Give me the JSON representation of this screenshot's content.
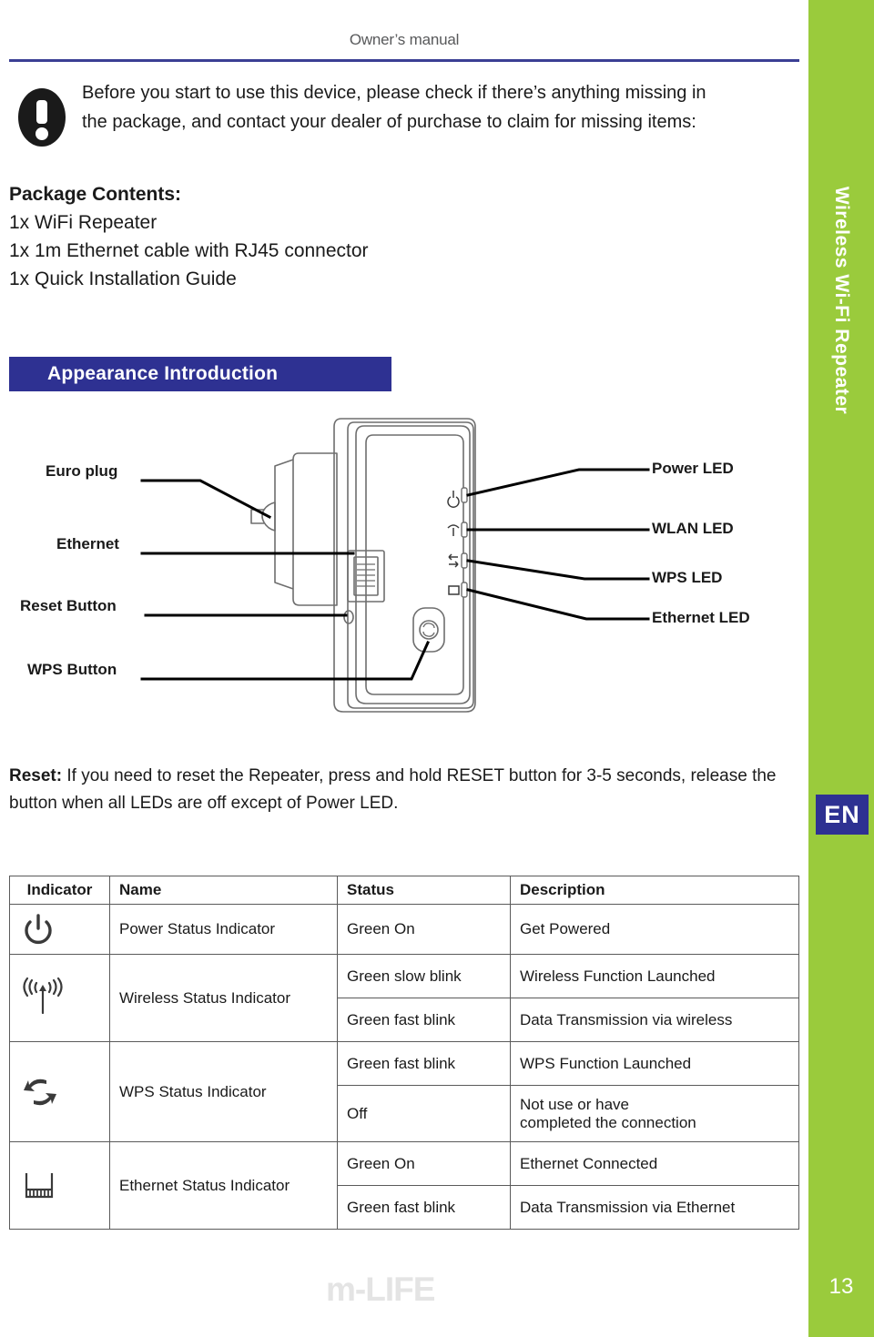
{
  "header": {
    "title": "Owner’s manual"
  },
  "sidebar": {
    "product_title": "Wireless Wi-Fi Repeater",
    "language_badge": "EN",
    "page_number": "13",
    "accent_green": "#9ACB3C",
    "accent_blue": "#2E3192"
  },
  "notice": {
    "icon": "exclamation-icon",
    "line1": "Before you start to use this device, please check if there’s anything missing in",
    "line2": "the package, and contact your dealer of purchase to claim for missing items:"
  },
  "package": {
    "title": "Package Contents:",
    "items": [
      "1x WiFi Repeater",
      "1x 1m Ethernet cable with RJ45 connector",
      "1x Quick Installation Guide"
    ]
  },
  "section": {
    "appearance_title": "Appearance Introduction"
  },
  "diagram": {
    "left_labels": [
      "Euro plug",
      "Ethernet",
      "Reset Button",
      "WPS Button"
    ],
    "right_labels": [
      "Power LED",
      "WLAN LED",
      "WPS LED",
      "Ethernet LED"
    ]
  },
  "reset_note": {
    "label": "Reset:",
    "text": " If you need to reset the Repeater, press and hold RESET button for 3-5 seconds, release the button when all LEDs are off except of Power LED."
  },
  "table": {
    "headers": [
      "Indicator",
      "Name",
      "Status",
      "Description"
    ],
    "rows": [
      {
        "icon": "power-icon",
        "name": "Power Status Indicator",
        "entries": [
          {
            "status": "Green On",
            "description": "Get Powered"
          }
        ]
      },
      {
        "icon": "wireless-antenna-icon",
        "name": "Wireless Status Indicator",
        "entries": [
          {
            "status": "Green slow blink",
            "description": "Wireless Function Launched"
          },
          {
            "status": "Green fast blink",
            "description": "Data Transmission via wireless"
          }
        ]
      },
      {
        "icon": "wps-arrows-icon",
        "name": "WPS Status Indicator",
        "entries": [
          {
            "status": "Green fast blink",
            "description": "WPS Function Launched"
          },
          {
            "status": "Off",
            "description_line1": "Not use or have",
            "description_line2": "completed the connection"
          }
        ]
      },
      {
        "icon": "ethernet-port-icon",
        "name": "Ethernet Status Indicator",
        "entries": [
          {
            "status": "Green On",
            "description": "Ethernet Connected"
          },
          {
            "status": "Green fast blink",
            "description": "Data Transmission via Ethernet"
          }
        ]
      }
    ]
  },
  "footer": {
    "brand": "m-LIFE"
  }
}
